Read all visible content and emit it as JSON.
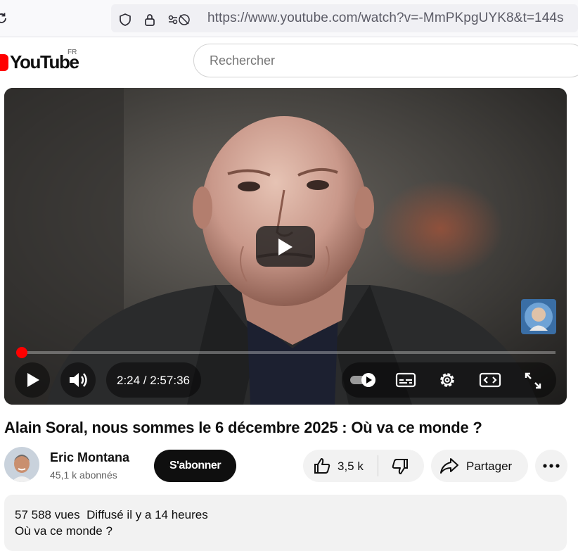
{
  "browser": {
    "url": "https://www.youtube.com/watch?v=-MmPKpgUYK8&t=144s"
  },
  "masthead": {
    "logo_text": "YouTube",
    "country_code": "FR",
    "search_placeholder": "Rechercher"
  },
  "player": {
    "current_time": "2:24",
    "duration": "2:57:36",
    "time_display": "2:24 / 2:57:36",
    "progress_fraction": 0.0135
  },
  "video": {
    "title": "Alain Soral, nous sommes le 6 décembre 2025 : Où va ce monde ?"
  },
  "channel": {
    "name": "Eric Montana",
    "subscribers": "45,1 k abonnés",
    "subscribe_label": "S'abonner"
  },
  "actions": {
    "like_count": "3,5 k",
    "share_label": "Partager"
  },
  "description": {
    "views": "57 588 vues",
    "published": "Diffusé il y a 14 heures",
    "meta_line": "57 588 vues  Diffusé il y a 14 heures",
    "second_line": "Où va ce monde ?"
  },
  "colors": {
    "brand_red": "#ff0000",
    "subscribe_bg": "#0f0f0f",
    "pill_bg": "#f2f2f2"
  },
  "icons": [
    "reload-icon",
    "shield-icon",
    "lock-icon",
    "permissions-icon",
    "play-icon",
    "volume-icon",
    "autoplay-toggle-icon",
    "subtitles-icon",
    "settings-icon",
    "miniplayer-icon",
    "fullscreen-icon",
    "like-icon",
    "dislike-icon",
    "share-icon",
    "more-icon"
  ]
}
